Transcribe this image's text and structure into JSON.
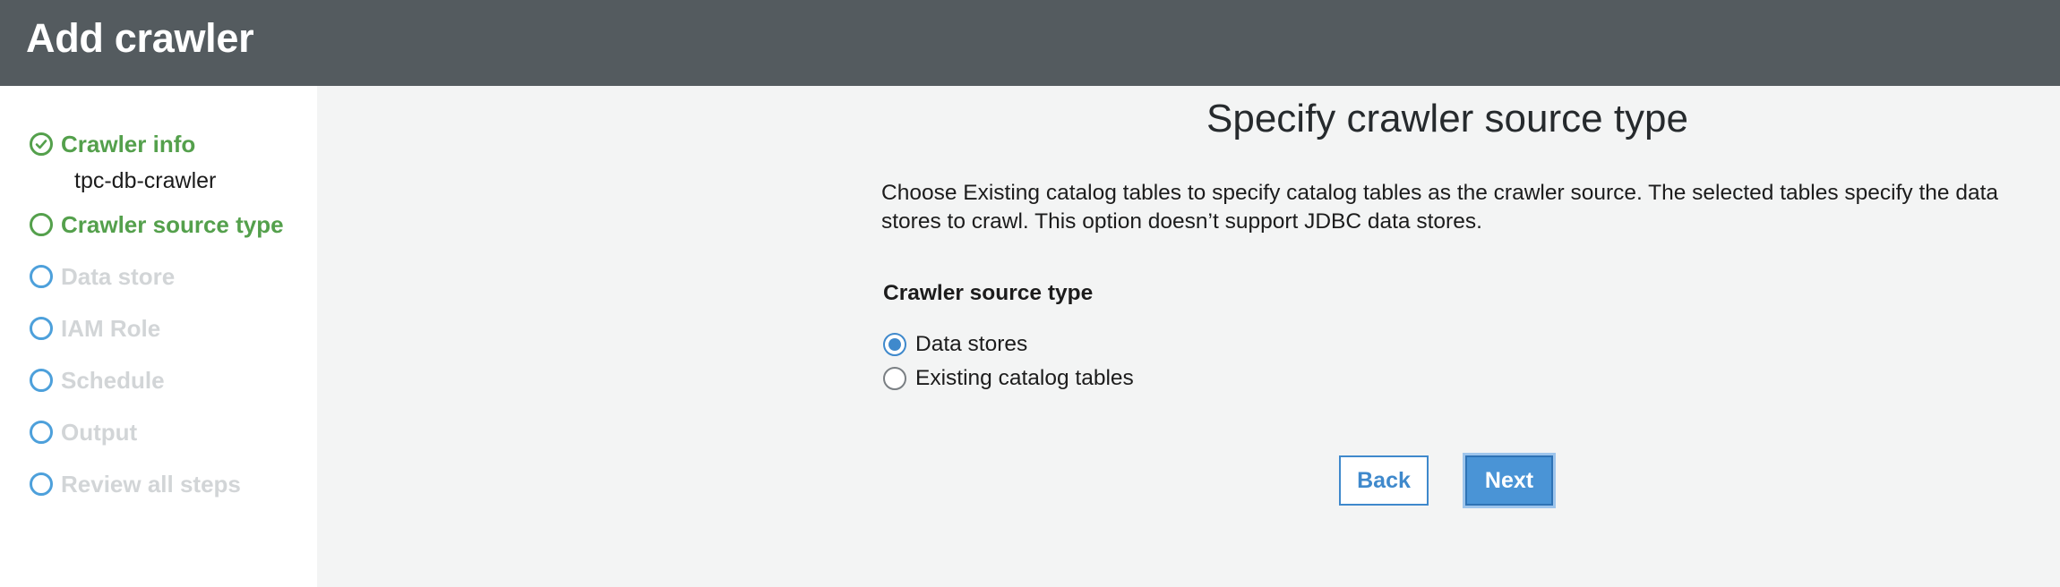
{
  "header": {
    "title": "Add crawler"
  },
  "sidebar": {
    "steps": [
      {
        "label": "Crawler info",
        "state": "done"
      },
      {
        "label": "Crawler source type",
        "state": "active"
      },
      {
        "label": "Data store",
        "state": "pending"
      },
      {
        "label": "IAM Role",
        "state": "pending"
      },
      {
        "label": "Schedule",
        "state": "pending"
      },
      {
        "label": "Output",
        "state": "pending"
      },
      {
        "label": "Review all steps",
        "state": "pending"
      }
    ],
    "crawler_name": "tpc-db-crawler"
  },
  "main": {
    "title": "Specify crawler source type",
    "description": "Choose Existing catalog tables to specify catalog tables as the crawler source. The selected tables specify the data stores to crawl. This option doesn’t support JDBC data stores.",
    "field_label": "Crawler source type",
    "options": [
      {
        "label": "Data stores",
        "selected": true
      },
      {
        "label": "Existing catalog tables",
        "selected": false
      }
    ],
    "back_label": "Back",
    "next_label": "Next"
  },
  "colors": {
    "header_bg": "#545b5f",
    "step_done": "#54a04c",
    "step_pending": "#4da0db",
    "primary": "#3f89cc"
  }
}
